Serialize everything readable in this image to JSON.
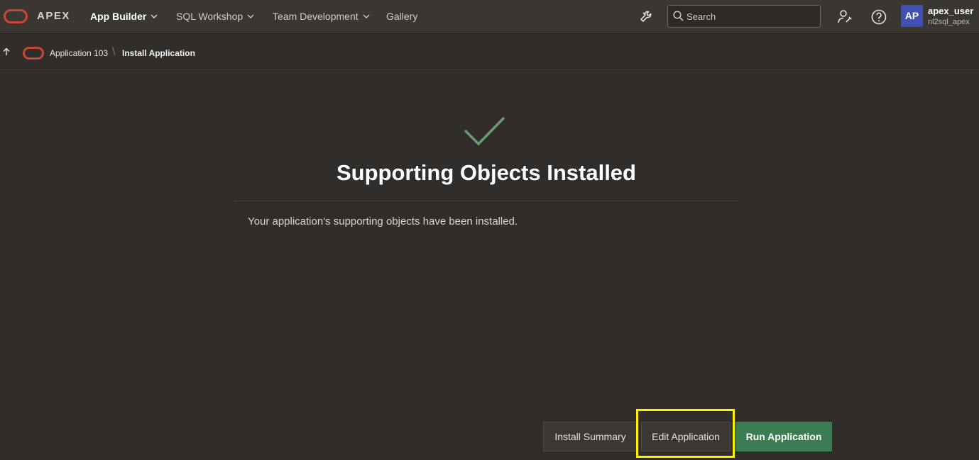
{
  "header": {
    "brand": "APEX",
    "nav": [
      {
        "label": "App Builder",
        "active": true,
        "has_menu": true
      },
      {
        "label": "SQL Workshop",
        "active": false,
        "has_menu": true
      },
      {
        "label": "Team Development",
        "active": false,
        "has_menu": true
      },
      {
        "label": "Gallery",
        "active": false,
        "has_menu": false
      }
    ],
    "icons": [
      "wrench-icon",
      "search-icon",
      "user-settings-icon",
      "help-icon"
    ],
    "search": {
      "placeholder": "Search",
      "value": ""
    },
    "user": {
      "initials": "AP",
      "name": "apex_user",
      "workspace": "nl2sql_apex"
    }
  },
  "breadcrumb": {
    "parent": "Application 103",
    "separator": "\\",
    "current": "Install Application"
  },
  "main": {
    "title": "Supporting Objects Installed",
    "message": "Your application's supporting objects have been installed."
  },
  "buttons": {
    "install_summary": "Install Summary",
    "edit_application": "Edit Application",
    "run_application": "Run Application"
  },
  "colors": {
    "background": "#312d2a",
    "header": "#3a3632",
    "oracle_red": "#c74634",
    "success_check": "#6a9b6e",
    "run_button": "#3a7d53",
    "avatar": "#3f51b5",
    "highlight": "#fff200"
  }
}
